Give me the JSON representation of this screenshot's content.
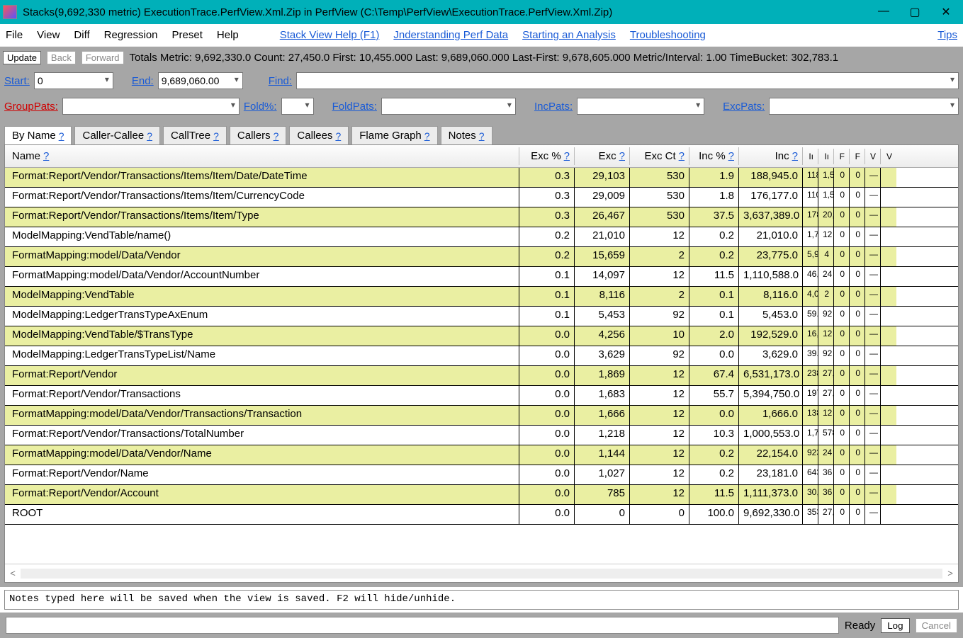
{
  "title": "Stacks(9,692,330 metric) ExecutionTrace.PerfView.Xml.Zip in PerfView (C:\\Temp\\PerfView\\ExecutionTrace.PerfView.Xml.Zip)",
  "window": {
    "min": "—",
    "max": "▢",
    "close": "✕"
  },
  "menu": {
    "items": [
      "File",
      "View",
      "Diff",
      "Regression",
      "Preset",
      "Help"
    ],
    "links": [
      "Stack View Help (F1)",
      "Jnderstanding Perf Data",
      "Starting an Analysis",
      "Troubleshooting",
      "Tips"
    ]
  },
  "toolbar1": {
    "update": "Update",
    "back": "Back",
    "forward": "Forward",
    "totals": "Totals Metric: 9,692,330.0   Count: 27,450.0   First: 10,455.000 Last: 9,689,060.000   Last-First: 9,678,605.000   Metric/Interval: 1.00   TimeBucket: 302,783.1"
  },
  "filters2": {
    "start_label": "Start:",
    "start_val": "0",
    "end_label": "End:",
    "end_val": "9,689,060.00",
    "find_label": "Find:"
  },
  "filters3": {
    "group_label": "GroupPats:",
    "foldpct_label": "Fold%:",
    "foldpats_label": "FoldPats:",
    "incpats_label": "IncPats:",
    "excpats_label": "ExcPats:"
  },
  "tabs": [
    {
      "label": "By Name",
      "q": "?",
      "active": true
    },
    {
      "label": "Caller-Callee",
      "q": "?"
    },
    {
      "label": "CallTree",
      "q": "?"
    },
    {
      "label": "Callers",
      "q": "?"
    },
    {
      "label": "Callees",
      "q": "?"
    },
    {
      "label": "Flame Graph",
      "q": "?"
    },
    {
      "label": "Notes",
      "q": "?"
    }
  ],
  "columns": [
    "Name",
    "Exc %",
    "Exc",
    "Exc Ct",
    "Inc %",
    "Inc",
    "Iı",
    "Iı",
    "F",
    "F",
    "V",
    "V"
  ],
  "colQ": "?",
  "rows": [
    {
      "alt": true,
      "name": "Format:Report/Vendor/Transactions/Items/Item/Date/DateTime",
      "excp": "0.3",
      "exc": "29,103",
      "excct": "530",
      "incp": "1.9",
      "inc": "188,945.0",
      "a": "118",
      "b": "1,5",
      "c": "0",
      "d": "0"
    },
    {
      "alt": false,
      "name": "Format:Report/Vendor/Transactions/Items/Item/CurrencyCode",
      "excp": "0.3",
      "exc": "29,009",
      "excct": "530",
      "incp": "1.8",
      "inc": "176,177.0",
      "a": "110",
      "b": "1,5",
      "c": "0",
      "d": "0"
    },
    {
      "alt": true,
      "name": "Format:Report/Vendor/Transactions/Items/Item/Type",
      "excp": "0.3",
      "exc": "26,467",
      "excct": "530",
      "incp": "37.5",
      "inc": "3,637,389.0",
      "a": "178",
      "b": "20,",
      "c": "0",
      "d": "0"
    },
    {
      "alt": false,
      "name": "ModelMapping:VendTable/name()",
      "excp": "0.2",
      "exc": "21,010",
      "excct": "12",
      "incp": "0.2",
      "inc": "21,010.0",
      "a": "1,7",
      "b": "12",
      "c": "0",
      "d": "0"
    },
    {
      "alt": true,
      "name": "FormatMapping:model/Data/Vendor",
      "excp": "0.2",
      "exc": "15,659",
      "excct": "2",
      "incp": "0.2",
      "inc": "23,775.0",
      "a": "5,9",
      "b": "4",
      "c": "0",
      "d": "0"
    },
    {
      "alt": false,
      "name": "FormatMapping:model/Data/Vendor/AccountNumber",
      "excp": "0.1",
      "exc": "14,097",
      "excct": "12",
      "incp": "11.5",
      "inc": "1,110,588.0",
      "a": "46,",
      "b": "24",
      "c": "0",
      "d": "0"
    },
    {
      "alt": true,
      "name": "ModelMapping:VendTable",
      "excp": "0.1",
      "exc": "8,116",
      "excct": "2",
      "incp": "0.1",
      "inc": "8,116.0",
      "a": "4,0",
      "b": "2",
      "c": "0",
      "d": "0"
    },
    {
      "alt": false,
      "name": "ModelMapping:LedgerTransTypeAxEnum",
      "excp": "0.1",
      "exc": "5,453",
      "excct": "92",
      "incp": "0.1",
      "inc": "5,453.0",
      "a": "59.",
      "b": "92",
      "c": "0",
      "d": "0"
    },
    {
      "alt": true,
      "name": "ModelMapping:VendTable/$TransType",
      "excp": "0.0",
      "exc": "4,256",
      "excct": "10",
      "incp": "2.0",
      "inc": "192,529.0",
      "a": "16,",
      "b": "12",
      "c": "0",
      "d": "0"
    },
    {
      "alt": false,
      "name": "ModelMapping:LedgerTransTypeList/Name",
      "excp": "0.0",
      "exc": "3,629",
      "excct": "92",
      "incp": "0.0",
      "inc": "3,629.0",
      "a": "39.",
      "b": "92",
      "c": "0",
      "d": "0"
    },
    {
      "alt": true,
      "name": "Format:Report/Vendor",
      "excp": "0.0",
      "exc": "1,869",
      "excct": "12",
      "incp": "67.4",
      "inc": "6,531,173.0",
      "a": "238",
      "b": "27,",
      "c": "0",
      "d": "0"
    },
    {
      "alt": false,
      "name": "Format:Report/Vendor/Transactions",
      "excp": "0.0",
      "exc": "1,683",
      "excct": "12",
      "incp": "55.7",
      "inc": "5,394,750.0",
      "a": "197",
      "b": "27,",
      "c": "0",
      "d": "0"
    },
    {
      "alt": true,
      "name": "FormatMapping:model/Data/Vendor/Transactions/Transaction",
      "excp": "0.0",
      "exc": "1,666",
      "excct": "12",
      "incp": "0.0",
      "inc": "1,666.0",
      "a": "138",
      "b": "12",
      "c": "0",
      "d": "0"
    },
    {
      "alt": false,
      "name": "Format:Report/Vendor/Transactions/TotalNumber",
      "excp": "0.0",
      "exc": "1,218",
      "excct": "12",
      "incp": "10.3",
      "inc": "1,000,553.0",
      "a": "1,7",
      "b": "578",
      "c": "0",
      "d": "0"
    },
    {
      "alt": true,
      "name": "FormatMapping:model/Data/Vendor/Name",
      "excp": "0.0",
      "exc": "1,144",
      "excct": "12",
      "incp": "0.2",
      "inc": "22,154.0",
      "a": "923",
      "b": "24",
      "c": "0",
      "d": "0"
    },
    {
      "alt": false,
      "name": "Format:Report/Vendor/Name",
      "excp": "0.0",
      "exc": "1,027",
      "excct": "12",
      "incp": "0.2",
      "inc": "23,181.0",
      "a": "643",
      "b": "36",
      "c": "0",
      "d": "0"
    },
    {
      "alt": true,
      "name": "Format:Report/Vendor/Account",
      "excp": "0.0",
      "exc": "785",
      "excct": "12",
      "incp": "11.5",
      "inc": "1,111,373.0",
      "a": "30,",
      "b": "36",
      "c": "0",
      "d": "0"
    },
    {
      "alt": false,
      "name": "ROOT",
      "excp": "0.0",
      "exc": "0",
      "excct": "0",
      "incp": "100.0",
      "inc": "9,692,330.0",
      "a": "353",
      "b": "27,",
      "c": "0",
      "d": "0"
    }
  ],
  "notes_placeholder": "Notes typed here will be saved when the view is saved. F2 will hide/unhide.",
  "status": {
    "ready": "Ready",
    "log": "Log",
    "cancel": "Cancel"
  }
}
